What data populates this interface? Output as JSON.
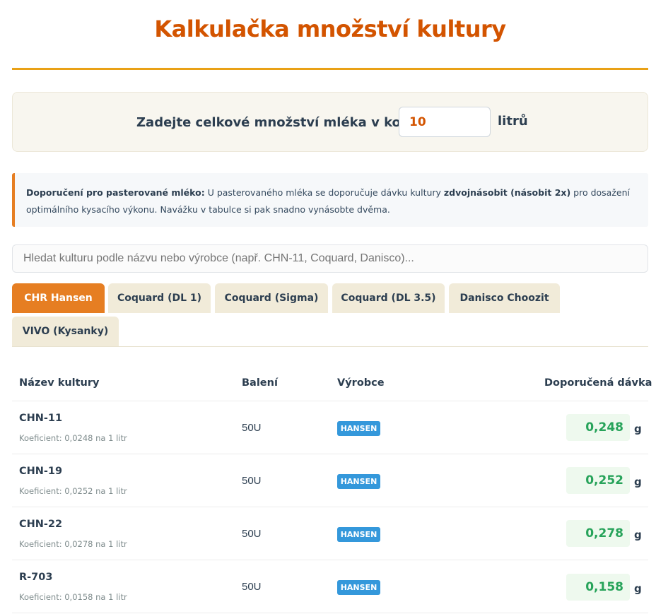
{
  "page": {
    "title": "Kalkulačka množství kultury"
  },
  "milk_input": {
    "label": "Zadejte celkové množství mléka v kotli:",
    "value": "10",
    "unit": "litrů"
  },
  "note": {
    "bold_prefix": "Doporučení pro pasterované mléko:",
    "text_1": " U pasterovaného mléka se doporučuje dávku kultury ",
    "bold_mid": "zdvojnásobit (násobit 2x)",
    "text_2": " pro dosažení optimálního kysacího výkonu. Navážku v tabulce si pak snadno vynásobte dvěma."
  },
  "search": {
    "placeholder": "Hledat kulturu podle názvu nebo výrobce (např. CHN-11, Coquard, Danisco)..."
  },
  "tabs": [
    {
      "label": "CHR Hansen",
      "active": true
    },
    {
      "label": "Coquard (DL 1)",
      "active": false
    },
    {
      "label": "Coquard (Sigma)",
      "active": false
    },
    {
      "label": "Coquard (DL 3.5)",
      "active": false
    },
    {
      "label": "Danisco Choozit",
      "active": false
    },
    {
      "label": "VIVO (Kysanky)",
      "active": false
    }
  ],
  "table": {
    "headers": {
      "name": "Název kultury",
      "pack": "Balení",
      "maker": "Výrobce",
      "dose": "Doporučená dávka"
    },
    "rows": [
      {
        "name": "CHN-11",
        "coef": "Koeficient: 0,0248 na 1 litr",
        "pack": "50U",
        "maker": "HANSEN",
        "dose": "0,248",
        "unit": "g"
      },
      {
        "name": "CHN-19",
        "coef": "Koeficient: 0,0252 na 1 litr",
        "pack": "50U",
        "maker": "HANSEN",
        "dose": "0,252",
        "unit": "g"
      },
      {
        "name": "CHN-22",
        "coef": "Koeficient: 0,0278 na 1 litr",
        "pack": "50U",
        "maker": "HANSEN",
        "dose": "0,278",
        "unit": "g"
      },
      {
        "name": "R-703",
        "coef": "Koeficient: 0,0158 na 1 litr",
        "pack": "50U",
        "maker": "HANSEN",
        "dose": "0,158",
        "unit": "g"
      }
    ]
  },
  "colors": {
    "accent": "#e67e22",
    "title": "#d35400",
    "badge": "#3498db",
    "dose_text": "#27a35a",
    "dose_bg": "#eef9ee"
  }
}
